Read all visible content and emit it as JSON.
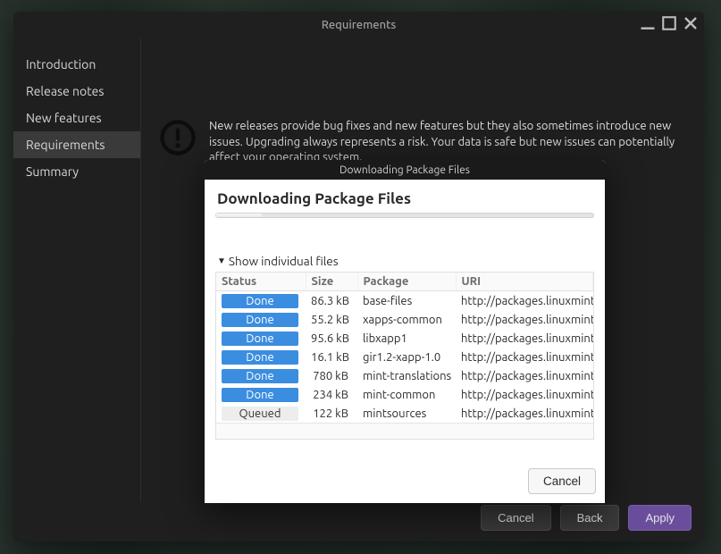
{
  "window": {
    "title": "Requirements"
  },
  "sidebar": {
    "items": [
      {
        "label": "Introduction"
      },
      {
        "label": "Release notes"
      },
      {
        "label": "New features"
      },
      {
        "label": "Requirements"
      },
      {
        "label": "Summary"
      }
    ],
    "active_index": 3
  },
  "main": {
    "warning_text": "New releases provide bug fixes and new features but they also sometimes introduce new issues. Upgrading always represents a risk. Your data is safe but new issues can potentially affect your operating system.",
    "checkbox_checked": true
  },
  "footer": {
    "cancel_label": "Cancel",
    "back_label": "Back",
    "apply_label": "Apply"
  },
  "dialog": {
    "titlebar": "Downloading Package Files",
    "heading": "Downloading Package Files",
    "expander_label": "Show individual files",
    "expander_expanded": true,
    "columns": {
      "status": "Status",
      "size": "Size",
      "package": "Package",
      "uri": "URI"
    },
    "status_labels": {
      "done": "Done",
      "queued": "Queued"
    },
    "rows": [
      {
        "status": "done",
        "size": "86.3 kB",
        "package": "base-files",
        "uri": "http://packages.linuxmint"
      },
      {
        "status": "done",
        "size": "55.2 kB",
        "package": "xapps-common",
        "uri": "http://packages.linuxmint"
      },
      {
        "status": "done",
        "size": "95.6 kB",
        "package": "libxapp1",
        "uri": "http://packages.linuxmint"
      },
      {
        "status": "done",
        "size": "16.1 kB",
        "package": "gir1.2-xapp-1.0",
        "uri": "http://packages.linuxmint"
      },
      {
        "status": "done",
        "size": "780 kB",
        "package": "mint-translations",
        "uri": "http://packages.linuxmint"
      },
      {
        "status": "done",
        "size": "234 kB",
        "package": "mint-common",
        "uri": "http://packages.linuxmint"
      },
      {
        "status": "queued",
        "size": "122 kB",
        "package": "mintsources",
        "uri": "http://packages.linuxmint"
      }
    ],
    "cancel_label": "Cancel"
  }
}
